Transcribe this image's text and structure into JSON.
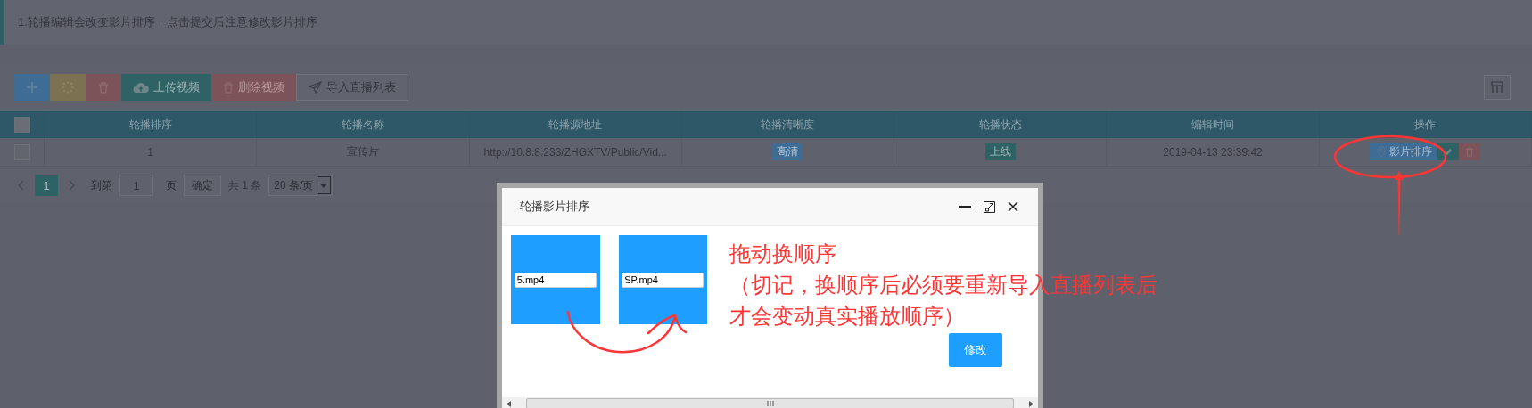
{
  "notice": "1.轮播编辑会改变影片排序，点击提交后注意修改影片排序",
  "toolbar": {
    "buttons": [
      {
        "kind": "add"
      },
      {
        "kind": "refresh"
      },
      {
        "kind": "trash"
      },
      {
        "kind": "upload",
        "label": "上传视频"
      },
      {
        "kind": "trash",
        "label": "删除视频"
      },
      {
        "kind": "import",
        "label": "导入直播列表"
      }
    ]
  },
  "table": {
    "all_checked": false,
    "columns": [
      "轮播排序",
      "轮播名称",
      "轮播源地址",
      "轮播清晰度",
      "轮播状态",
      "编辑时间",
      "操作"
    ],
    "rows": [
      {
        "checked": false,
        "order": "1",
        "name": "宣传片",
        "url": "http://10.8.8.233/ZHGXTV/Public/Vid...",
        "quality": "高清",
        "status": "上线",
        "time": "2019-04-13 23:39:42",
        "actions": [
          {
            "kind": "sort",
            "label": "影片排序"
          },
          {
            "kind": "edit"
          },
          {
            "kind": "trash"
          }
        ]
      }
    ]
  },
  "pagination": {
    "pages": [
      {
        "label": "1",
        "selected": true
      }
    ],
    "goto_label": "到第",
    "page_input": "1",
    "page_unit": "页",
    "confirm": "确定",
    "total": "共 1 条",
    "page_size": "20 条/页"
  },
  "modal": {
    "title": "轮播影片排序",
    "tiles": [
      {
        "value": "5.mp4"
      },
      {
        "value": "SP.mp4"
      }
    ],
    "note_lines": [
      "拖动换顺序",
      "（切记，换顺序后必须要重新导入直播列表后",
      "才会变动真实播放顺序）"
    ],
    "submit": "修改"
  }
}
